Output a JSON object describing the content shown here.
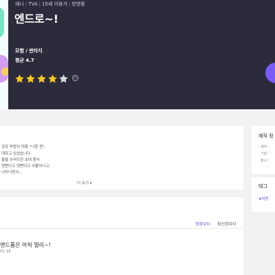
{
  "header": {
    "meta": [
      "애니",
      "TVA",
      "15세 이용가",
      "방영중"
    ],
    "title": "엔드로~!",
    "genre": "모험 / 판타지",
    "rating_label": "평균 4.7",
    "stars": {
      "filled": 4,
      "total": 5
    },
    "info_icon_char": "©"
  },
  "synopsis": {
    "lines": [
      "검과 마법의 대륙 \"나항 원\",",
      "대하고 있었습니다.",
      "둘을 쓰러뜨린 초대 용사",
      "뎃뻔이고 뎃뻔이고 되풀이나고,",
      "나타나면서..."
    ],
    "more_label": "더 보기 ▾"
  },
  "episodes": {
    "sort_first": "첫화부터",
    "sort_recent": "최신화부터",
    "items": [
      {
        "title": "엔드롬은 아직 멀리~!",
        "date": "01.18"
      }
    ]
  },
  "sidebar": {
    "production_title": "제작 정",
    "production_lines": [
      "· 제작 :",
      "· 기본 :",
      "· 출시 :"
    ],
    "tags_title": "태그",
    "tags": [
      "#마뭇"
    ]
  },
  "colors": {
    "accent": "#7a5cf6",
    "star": "#f6c51f",
    "star_empty": "#d7d7dd",
    "hero_bg": "#2b2b3b"
  }
}
